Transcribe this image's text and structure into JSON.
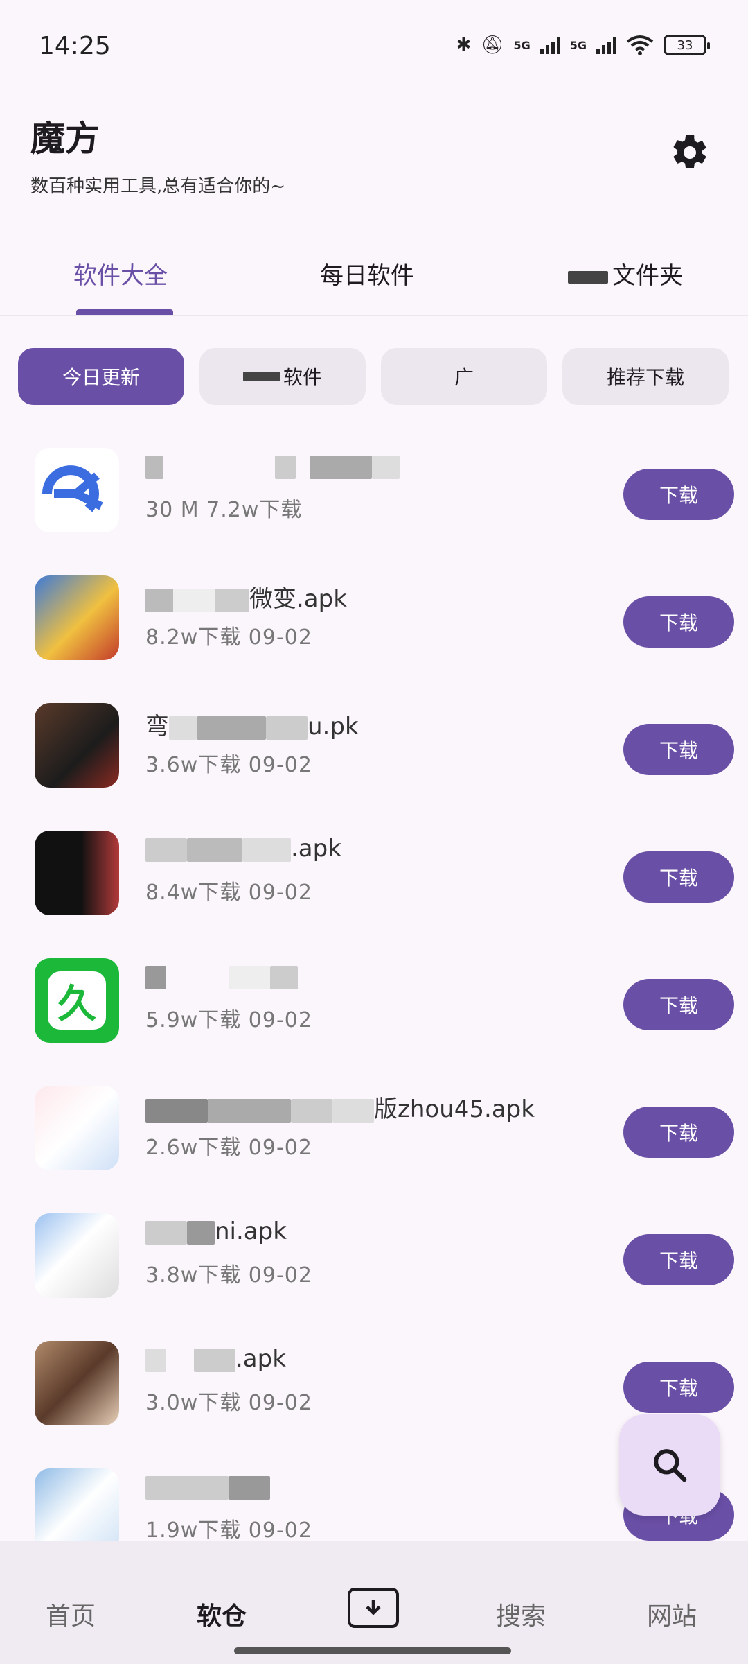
{
  "status_bar": {
    "time": "14:25",
    "network_1": "5G",
    "network_2": "5G",
    "battery": "33",
    "icons": [
      "bluetooth-icon",
      "mute-bell-icon",
      "signal-icon",
      "wifi-icon",
      "battery-icon"
    ]
  },
  "header": {
    "title": "魔方",
    "subtitle": "数百种实用工具,总有适合你的~",
    "settings_icon": "gear-icon"
  },
  "tabs": [
    {
      "label": "软件大全",
      "active": true
    },
    {
      "label": "每日软件",
      "active": false
    },
    {
      "label": "文件夹",
      "active": false
    }
  ],
  "chips": [
    {
      "label": "今日更新",
      "active": true
    },
    {
      "label": "软件",
      "active": false
    },
    {
      "label": "广",
      "active": false
    },
    {
      "label": "推荐下载",
      "active": false
    }
  ],
  "download_label": "下载",
  "items": [
    {
      "name": "",
      "meta": "30 M  7.2w下载",
      "icon_color": "#3b6de0"
    },
    {
      "name": "微变.apk",
      "meta": "8.2w下载  09-02",
      "icon_color": "#4a7bc4"
    },
    {
      "name": "弯",
      "name_end": "u.pk",
      "meta": "3.6w下载  09-02",
      "icon_color": "#3a2a22"
    },
    {
      "name": ".apk",
      "meta": "8.4w下载  09-02",
      "icon_color": "#1e1e1e"
    },
    {
      "name": "",
      "meta": "5.9w下载  09-02",
      "icon_color": "#1cb83a"
    },
    {
      "name": "版zhou45.apk",
      "meta": "2.6w下载  09-02",
      "icon_color": "#f7e4e6"
    },
    {
      "name": "ni.apk",
      "meta": "3.8w下载  09-02",
      "icon_color": "#dfe9f7"
    },
    {
      "name": ".apk",
      "meta": "3.0w下载  09-02",
      "icon_color": "#8a6a4c"
    },
    {
      "name": "",
      "meta": "1.9w下载  09-02",
      "icon_color": "#cfe2f5"
    }
  ],
  "fab_icon": "search-icon",
  "bottom_nav": [
    {
      "label": "首页",
      "active": false
    },
    {
      "label": "软仓",
      "active": true
    },
    {
      "label": "",
      "icon": "download-icon",
      "active": false
    },
    {
      "label": "搜索",
      "active": false
    },
    {
      "label": "网站",
      "active": false
    }
  ]
}
